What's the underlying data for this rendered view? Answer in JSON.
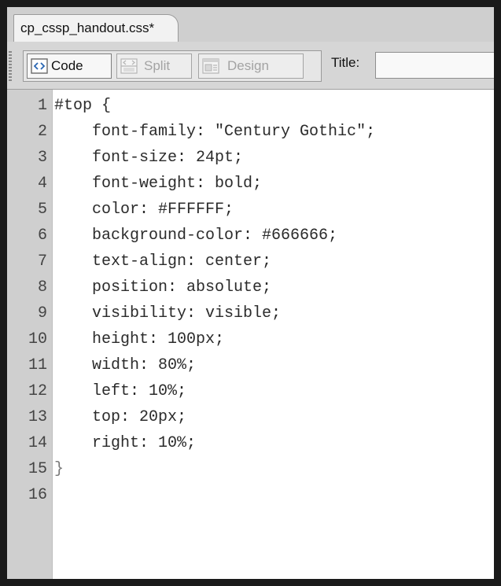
{
  "document": {
    "tab_title": "cp_cssp_handout.css*"
  },
  "toolbar": {
    "views": [
      {
        "label": "Code",
        "icon": "code-view-icon",
        "active": true
      },
      {
        "label": "Split",
        "icon": "split-view-icon",
        "active": false
      },
      {
        "label": "Design",
        "icon": "design-view-icon",
        "active": false
      }
    ],
    "title_label": "Title:",
    "title_value": ""
  },
  "editor": {
    "lines": [
      {
        "number": "1",
        "text": "#top {"
      },
      {
        "number": "2",
        "text": "    font-family: \"Century Gothic\";"
      },
      {
        "number": "3",
        "text": "    font-size: 24pt;"
      },
      {
        "number": "4",
        "text": "    font-weight: bold;"
      },
      {
        "number": "5",
        "text": "    color: #FFFFFF;"
      },
      {
        "number": "6",
        "text": "    background-color: #666666;"
      },
      {
        "number": "7",
        "text": "    text-align: center;"
      },
      {
        "number": "8",
        "text": "    position: absolute;"
      },
      {
        "number": "9",
        "text": "    visibility: visible;"
      },
      {
        "number": "10",
        "text": "    height: 100px;"
      },
      {
        "number": "11",
        "text": "    width: 80%;"
      },
      {
        "number": "12",
        "text": "    left: 10%;"
      },
      {
        "number": "13",
        "text": "    top: 20px;"
      },
      {
        "number": "14",
        "text": "    right: 10%;"
      },
      {
        "number": "15",
        "text": "}"
      },
      {
        "number": "16",
        "text": ""
      }
    ]
  },
  "colors": {
    "frame_border": "#1a1a1a",
    "gutter_bg": "#cfcfcf",
    "toolbar_bg": "#d6d6d6",
    "code_text": "#2b2b2b",
    "disabled_text": "#a3a3a3"
  }
}
